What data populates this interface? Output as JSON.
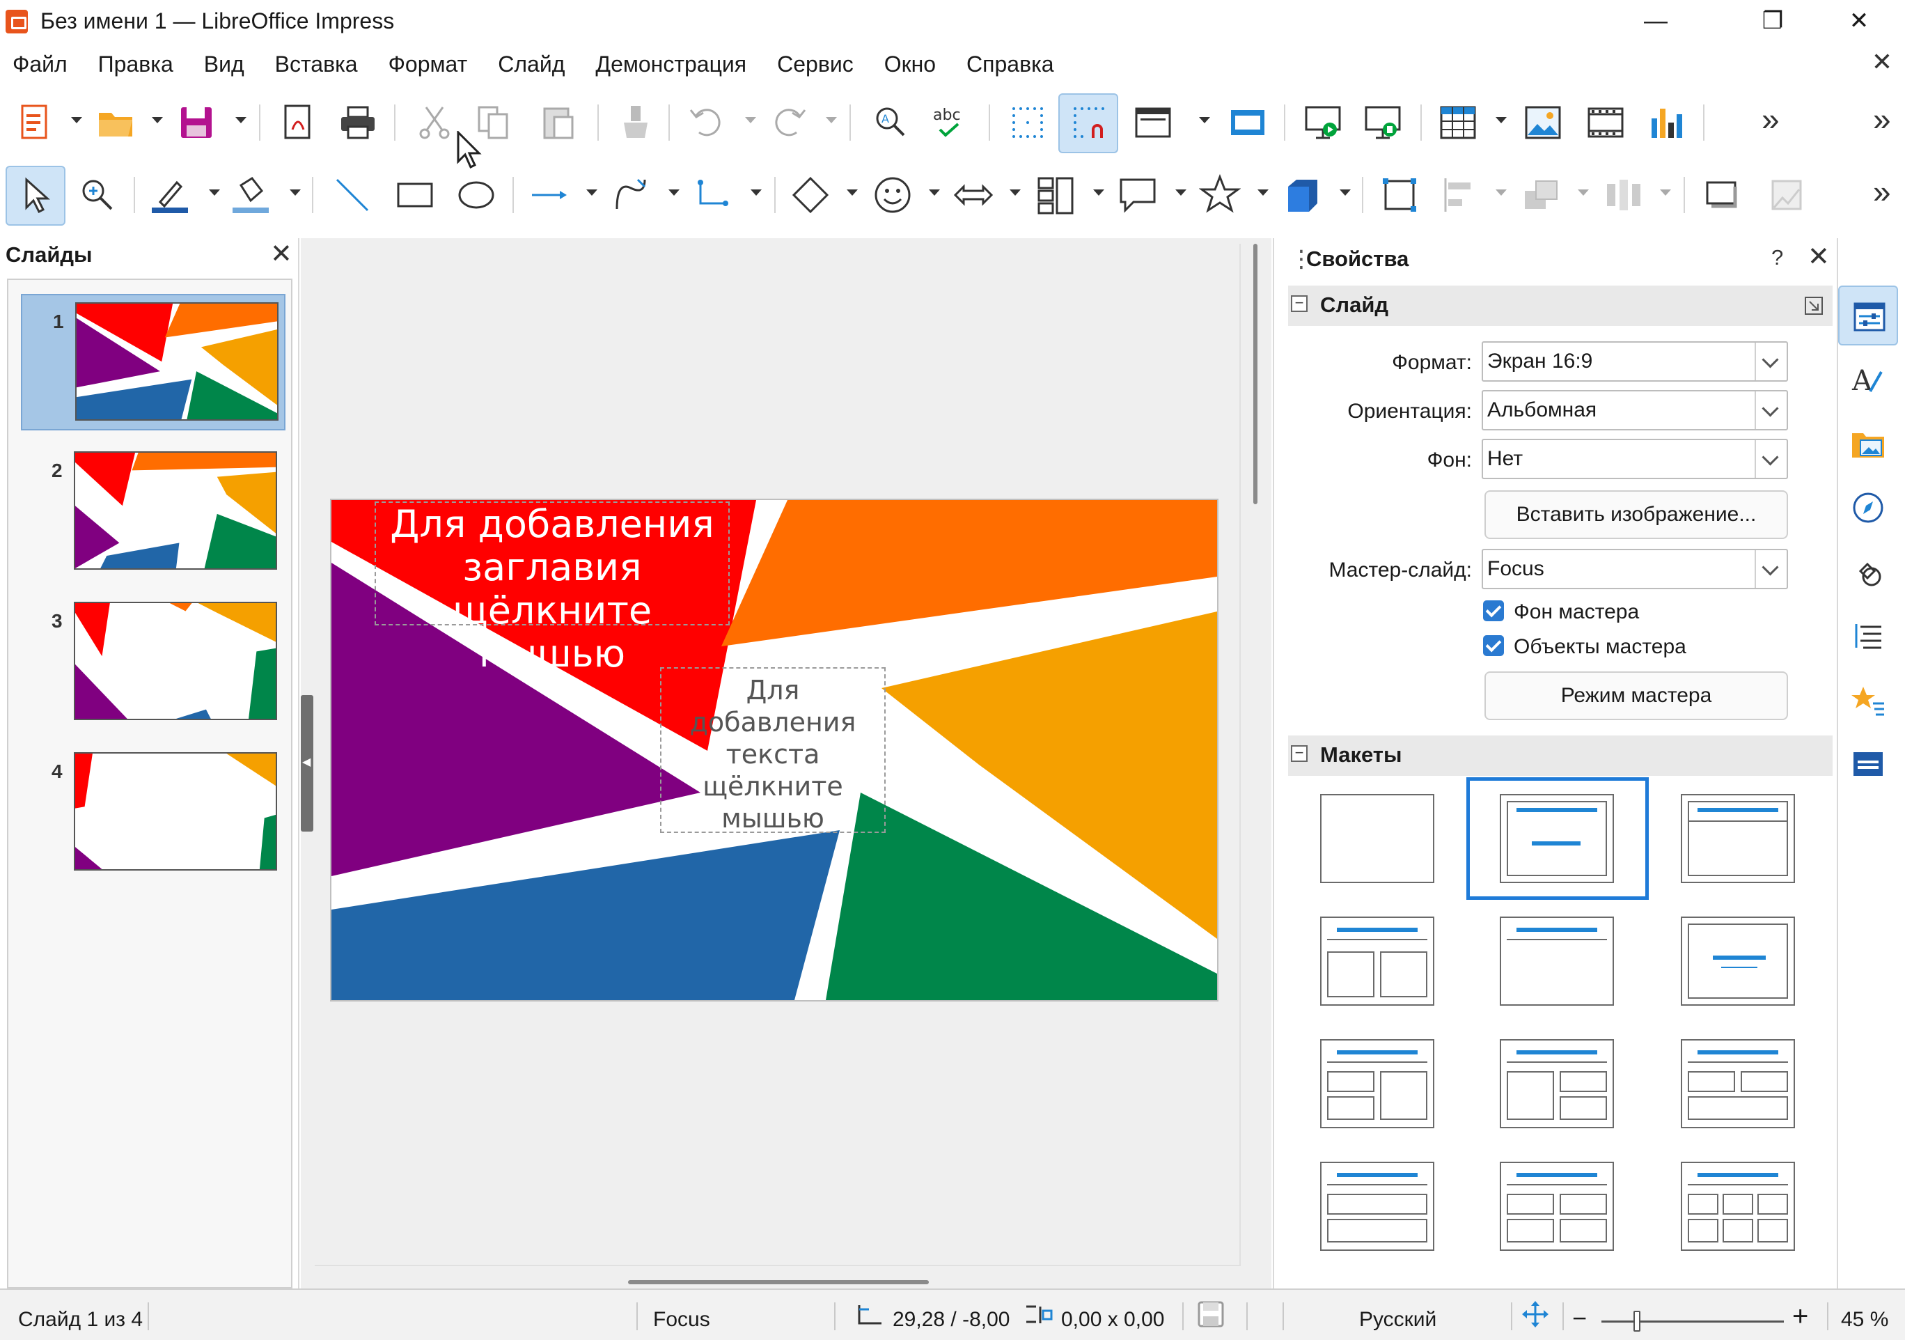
{
  "window": {
    "title": "Без имени 1 — LibreOffice Impress",
    "minimize": "—",
    "restore": "❐",
    "close": "✕"
  },
  "menu": {
    "items": [
      "Файл",
      "Правка",
      "Вид",
      "Вставка",
      "Формат",
      "Слайд",
      "Демонстрация",
      "Сервис",
      "Окно",
      "Справка"
    ],
    "close": "✕"
  },
  "toolbar": {
    "overflow": "»"
  },
  "slides_pane": {
    "title": "Слайды",
    "close": "✕",
    "slides": [
      {
        "number": "1",
        "selected": true
      },
      {
        "number": "2",
        "selected": false
      },
      {
        "number": "3",
        "selected": false
      },
      {
        "number": "4",
        "selected": false
      }
    ]
  },
  "slide": {
    "title_placeholder": "Для добавления заглавия щёлкните мышью",
    "text_placeholder": "Для добавления текста щёлкните мышью"
  },
  "properties": {
    "title": "Свойства",
    "help": "?",
    "close": "✕",
    "menu": "≡",
    "slide_section": {
      "title": "Слайд",
      "format_label": "Формат:",
      "format_value": "Экран 16:9",
      "orientation_label": "Ориентация:",
      "orientation_value": "Альбомная",
      "background_label": "Фон:",
      "background_value": "Нет",
      "insert_image_button": "Вставить изображение...",
      "master_label": "Мастер-слайд:",
      "master_value": "Focus",
      "master_background": "Фон мастера",
      "master_objects": "Объекты мастера",
      "master_mode_button": "Режим мастера"
    },
    "layouts_section": {
      "title": "Макеты"
    }
  },
  "statusbar": {
    "slide_info": "Слайд 1 из 4",
    "master": "Focus",
    "position": "29,28 / -8,00",
    "size": "0,00 x 0,00",
    "language": "Русский",
    "zoom": "45 %"
  },
  "colors": {
    "red": "#ff0000",
    "orange": "#ff6d00",
    "amber": "#f5a000",
    "purple": "#800080",
    "blue": "#2166a8",
    "green": "#00864a",
    "accent": "#1f7bd8"
  }
}
